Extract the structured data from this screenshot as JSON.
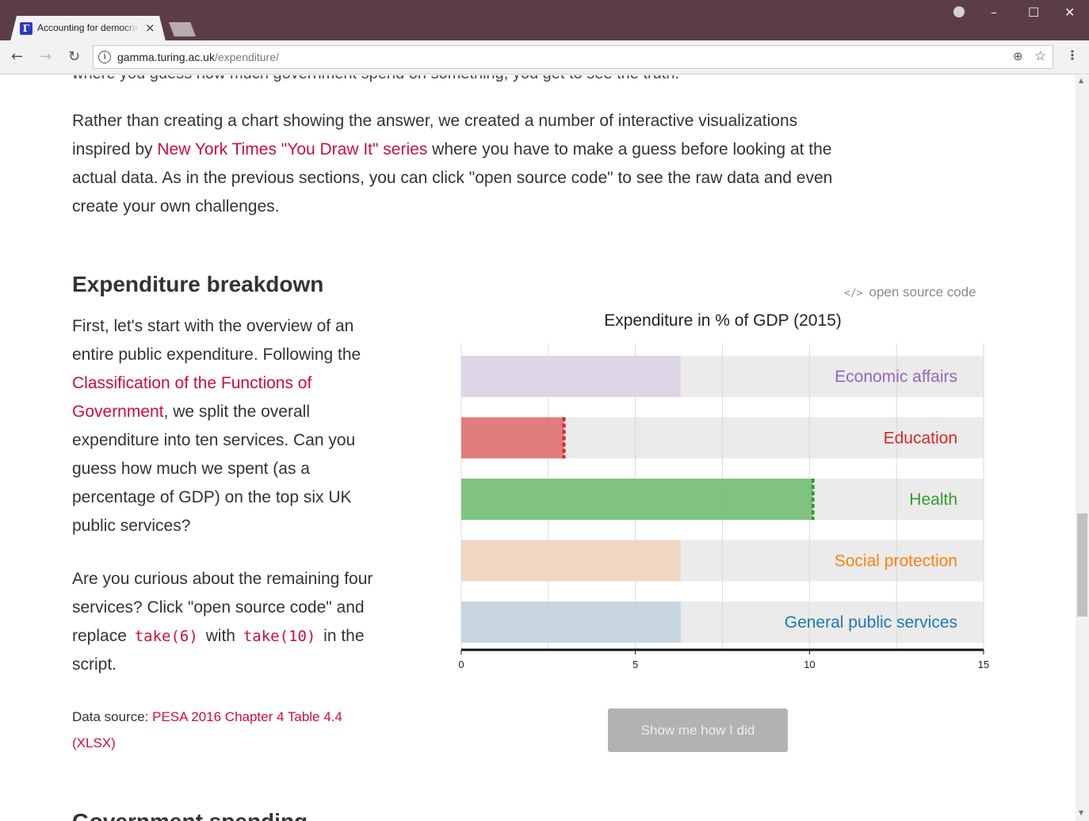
{
  "browser": {
    "tab_title": "Accounting for democracy",
    "favicon_letter": "Γ",
    "tab_close": "×",
    "url_host": "gamma.turing.ac.uk",
    "url_path": "/expenditure/",
    "window_controls": [
      "minimize",
      "maximize",
      "close"
    ],
    "icons": [
      "back-arrow-icon",
      "forward-arrow-icon",
      "reload-icon",
      "info-icon",
      "zoom-icon",
      "star-icon",
      "menu-icon"
    ]
  },
  "page": {
    "cut_off_line": "where you guess how much government spend on something, you get to see the truth.",
    "intro": {
      "part1": "Rather than creating a chart showing the answer, we created a number of interactive visualizations inspired by ",
      "link": "New York Times \"You Draw It\" series",
      "part2": " where you have to make a guess before looking at the actual data. As in the previous sections, you can click \"open source code\" to see the raw data and even create your own challenges."
    },
    "section_title": "Expenditure breakdown",
    "para1": {
      "part1": "First, let's start with the overview of an entire public expenditure. Following the ",
      "link": "Classification of the Functions of Government",
      "part2": ", we split the overall expenditure into ten services. Can you guess how much we spent (as a percentage of GDP) on the top six UK public services?"
    },
    "para2": {
      "part1": "Are you curious about the remaining four services? Click \"open source code\" and replace ",
      "code1": "take(6)",
      "part2": " with ",
      "code2": "take(10)",
      "part3": " in the script."
    },
    "data_source": {
      "label": "Data source: ",
      "link": "PESA 2016 Chapter 4 Table 4.4 (XLSX)"
    },
    "open_source_label": "open source code",
    "show_button": "Show me how I did",
    "next_section_title": "Government spending"
  },
  "chart_data": {
    "type": "bar",
    "orientation": "horizontal",
    "title": "Expenditure in % of GDP (2015)",
    "xlim": [
      0,
      15
    ],
    "xticks": [
      0,
      5,
      10,
      15
    ],
    "grid": true,
    "track_max": 15,
    "series": [
      {
        "category": "Economic affairs",
        "value": 6.3,
        "revealed": false,
        "color": "#9467bd",
        "light": "#dcd2e6"
      },
      {
        "category": "Education",
        "value": 2.95,
        "revealed": true,
        "color": "#d62728",
        "light": "#e07272"
      },
      {
        "category": "Health",
        "value": 10.1,
        "revealed": true,
        "color": "#2ca02c",
        "light": "#77bf77"
      },
      {
        "category": "Social protection",
        "value": 6.3,
        "revealed": false,
        "color": "#ff7f0e",
        "light": "#efd5bf"
      },
      {
        "category": "General public services",
        "value": 6.3,
        "revealed": false,
        "color": "#1f77b4",
        "light": "#c3d3e0"
      }
    ]
  }
}
